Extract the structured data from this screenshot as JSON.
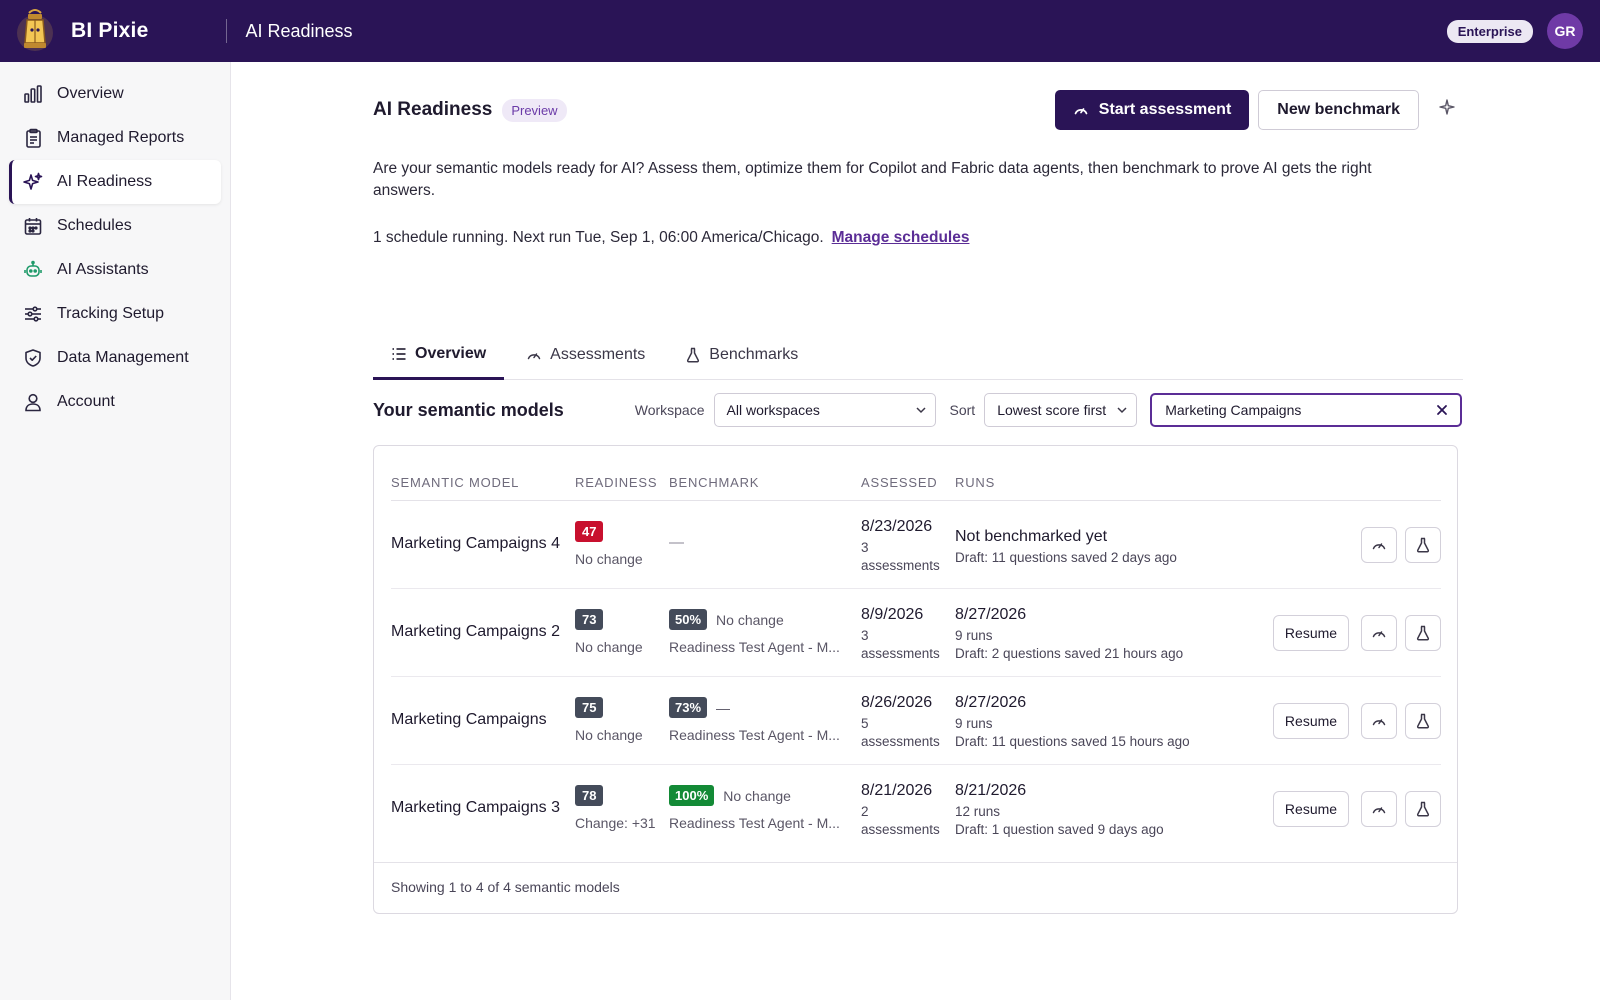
{
  "header": {
    "brand": "BI Pixie",
    "section_title": "AI Readiness",
    "plan_badge": "Enterprise",
    "avatar_initials": "GR"
  },
  "sidebar": {
    "items": [
      {
        "label": "Overview",
        "icon": "bar-chart-icon"
      },
      {
        "label": "Managed Reports",
        "icon": "report-clipboard-icon"
      },
      {
        "label": "AI Readiness",
        "icon": "sparkle-icon",
        "active": true
      },
      {
        "label": "Schedules",
        "icon": "calendar-icon"
      },
      {
        "label": "AI Assistants",
        "icon": "robot-icon"
      },
      {
        "label": "Tracking Setup",
        "icon": "sliders-icon"
      },
      {
        "label": "Data Management",
        "icon": "shield-icon"
      },
      {
        "label": "Account",
        "icon": "user-icon"
      }
    ]
  },
  "page": {
    "title": "AI Readiness",
    "badge": "Preview",
    "start_button": "Start assessment",
    "new_benchmark_button": "New benchmark",
    "intro": "Are your semantic models ready for AI? Assess them, optimize them for Copilot and Fabric data agents, then benchmark to prove AI gets the right answers.",
    "schedule_text": "1 schedule running. Next run Tue, Sep 1, 06:00 America/Chicago.",
    "schedule_link": "Manage schedules"
  },
  "tabs": [
    {
      "label": "Overview",
      "active": true
    },
    {
      "label": "Assessments"
    },
    {
      "label": "Benchmarks"
    }
  ],
  "filters": {
    "section_title": "Your semantic models",
    "workspace_label": "Workspace",
    "workspace_value": "All workspaces",
    "sort_label": "Sort",
    "sort_value": "Lowest score first",
    "search_value": "Marketing Campaigns"
  },
  "table": {
    "headers": [
      "SEMANTIC MODEL",
      "READINESS",
      "BENCHMARK",
      "ASSESSED",
      "RUNS"
    ],
    "rows": [
      {
        "name": "Marketing Campaigns 4",
        "score": "47",
        "score_color": "#c8102e",
        "score_change": "No change",
        "benchmark": "—",
        "benchmark_color": "",
        "benchmark_change": "",
        "benchmark_agent": "",
        "assessed_date": "8/23/2026",
        "assessed_count": "3 assessments",
        "runs_main": "Not benchmarked yet",
        "runs_count": "",
        "runs_draft": "Draft: 11 questions saved 2 days ago",
        "resume": ""
      },
      {
        "name": "Marketing Campaigns 2",
        "score": "73",
        "score_color": "#444b5a",
        "score_change": "No change",
        "benchmark": "50%",
        "benchmark_color": "#444b5a",
        "benchmark_change": "No change",
        "benchmark_agent": "Readiness Test Agent - M...",
        "assessed_date": "8/9/2026",
        "assessed_count": "3 assessments",
        "runs_main": "8/27/2026",
        "runs_count": "9 runs",
        "runs_draft": "Draft: 2 questions saved 21 hours ago",
        "resume": "Resume"
      },
      {
        "name": "Marketing Campaigns",
        "score": "75",
        "score_color": "#444b5a",
        "score_change": "No change",
        "benchmark": "73%",
        "benchmark_color": "#444b5a",
        "benchmark_change": "—",
        "benchmark_agent": "Readiness Test Agent - M...",
        "assessed_date": "8/26/2026",
        "assessed_count": "5 assessments",
        "runs_main": "8/27/2026",
        "runs_count": "9 runs",
        "runs_draft": "Draft: 11 questions saved 15 hours ago",
        "resume": "Resume"
      },
      {
        "name": "Marketing Campaigns 3",
        "score": "78",
        "score_color": "#444b5a",
        "score_change": "Change: +31",
        "benchmark": "100%",
        "benchmark_color": "#138a36",
        "benchmark_change": "No change",
        "benchmark_agent": "Readiness Test Agent - M...",
        "assessed_date": "8/21/2026",
        "assessed_count": "2 assessments",
        "runs_main": "8/21/2026",
        "runs_count": "12 runs",
        "runs_draft": "Draft: 1 question saved 9 days ago",
        "resume": "Resume"
      }
    ],
    "footer": "Showing 1 to 4 of 4 semantic models"
  },
  "colors": {
    "brand_dark": "#2a1456",
    "accent": "#5b2d96",
    "score_low": "#c8102e",
    "score_neutral": "#444b5a",
    "score_high": "#138a36"
  }
}
